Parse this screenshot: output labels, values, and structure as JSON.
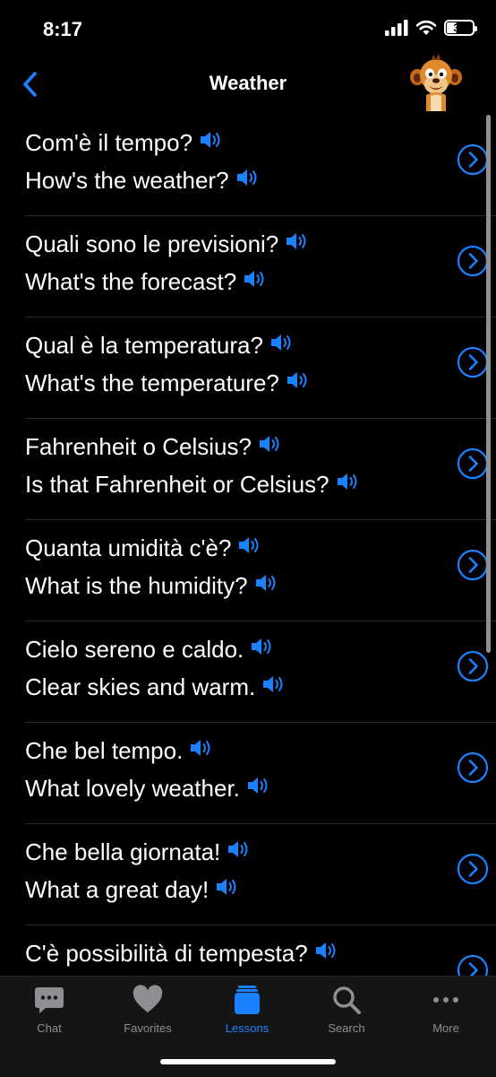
{
  "status_bar": {
    "time": "8:17",
    "battery": "31"
  },
  "header": {
    "title": "Weather"
  },
  "phrases": [
    {
      "italian": "Com'è il tempo?",
      "english": "How's the weather?"
    },
    {
      "italian": "Quali sono le previsioni?",
      "english": "What's the forecast?"
    },
    {
      "italian": "Qual è la temperatura?",
      "english": "What's the temperature?"
    },
    {
      "italian": "Fahrenheit o Celsius?",
      "english": "Is that Fahrenheit or Celsius?"
    },
    {
      "italian": "Quanta umidità c'è?",
      "english": "What is the humidity?"
    },
    {
      "italian": "Cielo sereno e caldo.",
      "english": "Clear skies and warm."
    },
    {
      "italian": "Che bel tempo.",
      "english": "What lovely weather."
    },
    {
      "italian": "Che bella giornata!",
      "english": "What a great day!"
    },
    {
      "italian": "C'è possibilità di tempesta?",
      "english": ""
    }
  ],
  "tabs": [
    {
      "label": "Chat",
      "icon": "chat-bubble-icon"
    },
    {
      "label": "Favorites",
      "icon": "heart-icon"
    },
    {
      "label": "Lessons",
      "icon": "lessons-icon",
      "active": true
    },
    {
      "label": "Search",
      "icon": "search-icon"
    },
    {
      "label": "More",
      "icon": "more-dots-icon"
    }
  ],
  "colors": {
    "accent": "#1a82ff",
    "background": "#000000",
    "tab_inactive": "#8e8e93"
  }
}
